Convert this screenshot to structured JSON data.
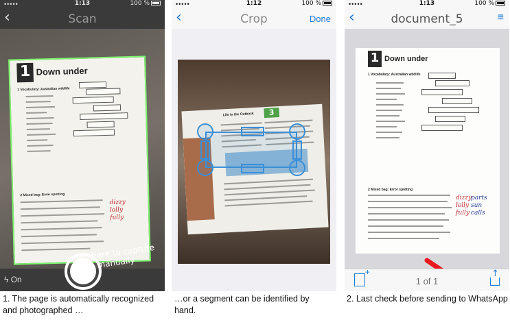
{
  "panel1": {
    "status": {
      "carrier": "•••••",
      "time": "1:13",
      "battery": "100 %"
    },
    "nav": {
      "back": "‹",
      "title": "Scan"
    },
    "doc": {
      "unit_num": "1",
      "unit_title": "Down under",
      "sec1": "1  Vocabulary: Australian wildlife",
      "sec2": "2  Mixed bag: Error spotting"
    },
    "hint": "Tap here to capture manually",
    "flash_label": "On",
    "caption": "1. The page is automatically recognized and photographed …"
  },
  "panel2": {
    "status": {
      "carrier": "•••••",
      "time": "1:12",
      "battery": "100 %"
    },
    "nav": {
      "back": "‹",
      "title": "Crop",
      "action": "Done"
    },
    "doc": {
      "badge": "3",
      "heading": "Life in the Outback"
    },
    "caption": "…or a segment can be identified by hand."
  },
  "panel3": {
    "status": {
      "carrier": "•••••",
      "time": "1:13",
      "battery": "100 %"
    },
    "nav": {
      "back": "‹",
      "title": "document_5",
      "menu": "≡"
    },
    "doc": {
      "unit_num": "1",
      "unit_title": "Down under",
      "sec1": "1  Vocabulary: Australian wildlife",
      "sec2": "2  Mixed bag: Error spotting"
    },
    "pageinfo": "1 of 1",
    "caption": "2. Last check before sending to WhatsApp"
  },
  "colors": {
    "ios_blue": "#1a7ad8",
    "arrow_red": "#e8191e",
    "scan_green": "#7cf56d"
  }
}
